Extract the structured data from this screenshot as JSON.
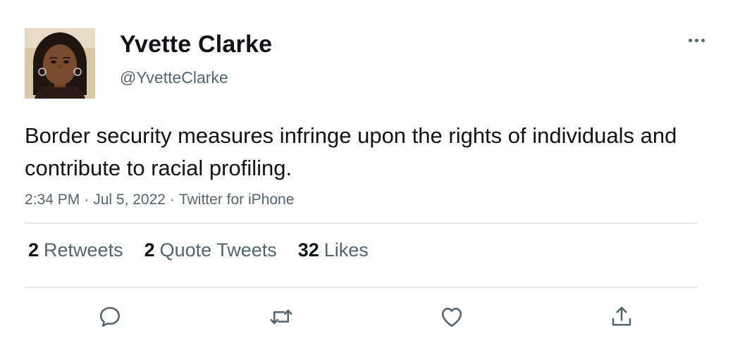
{
  "author": {
    "display_name": "Yvette Clarke",
    "handle": "@YvetteClarke"
  },
  "tweet": {
    "text": "Border security measures infringe upon the rights of individuals and contribute to racial profiling.",
    "time": "2:34 PM",
    "date": "Jul 5, 2022",
    "source": "Twitter for iPhone",
    "separator": "·"
  },
  "stats": [
    {
      "count": "2",
      "label": "Retweets"
    },
    {
      "count": "2",
      "label": "Quote Tweets"
    },
    {
      "count": "32",
      "label": "Likes"
    }
  ],
  "actions": [
    {
      "name": "reply",
      "icon": "reply-icon"
    },
    {
      "name": "retweet",
      "icon": "retweet-icon"
    },
    {
      "name": "like",
      "icon": "heart-icon"
    },
    {
      "name": "share",
      "icon": "share-icon"
    }
  ],
  "colors": {
    "text_primary": "#0f1419",
    "text_secondary": "#536471",
    "divider": "#e6e9eb"
  }
}
